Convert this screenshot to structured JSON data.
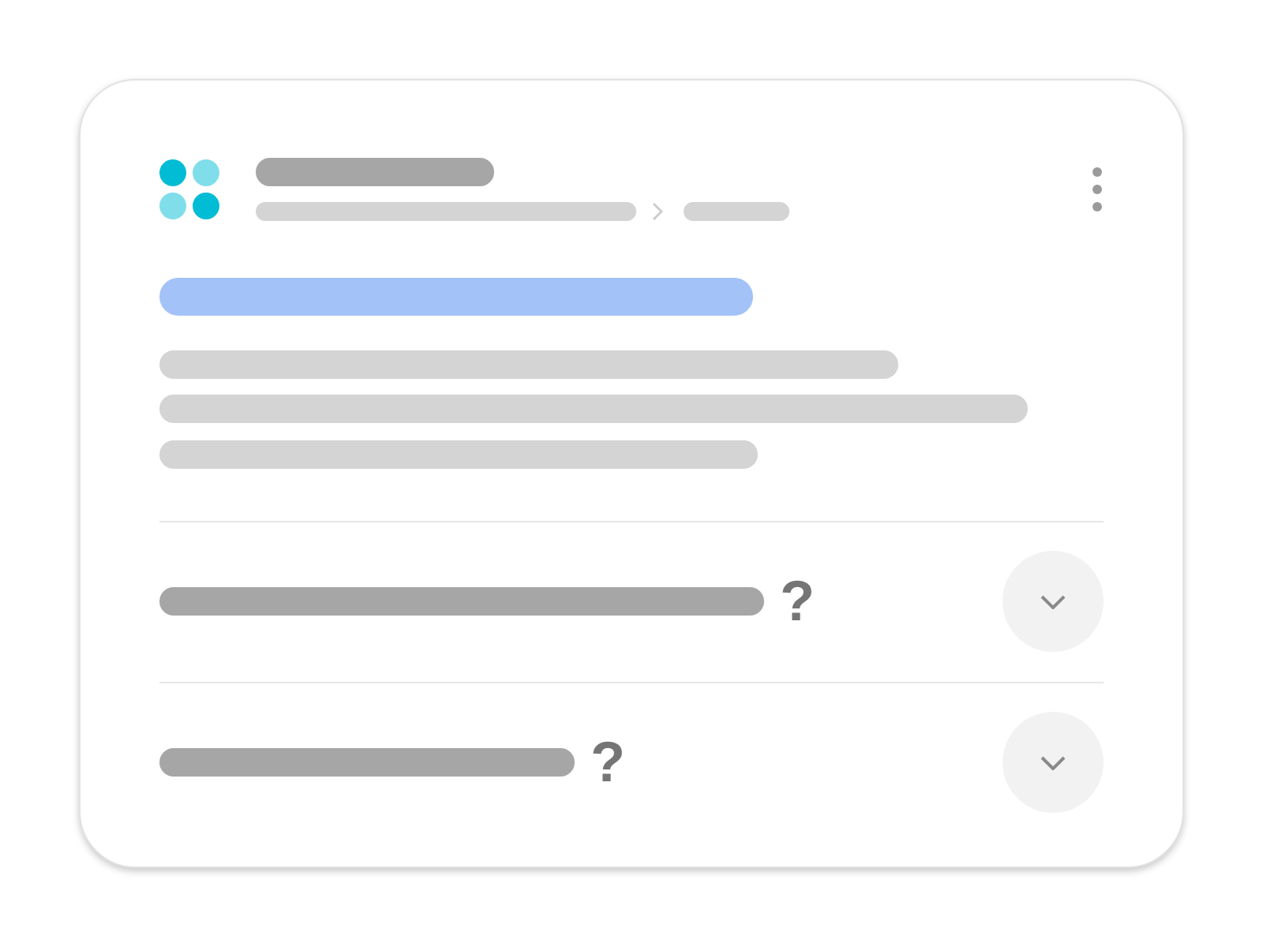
{
  "result": {
    "faq": [
      {
        "mark": "?",
        "expanded": false
      },
      {
        "mark": "?",
        "expanded": false
      }
    ]
  }
}
